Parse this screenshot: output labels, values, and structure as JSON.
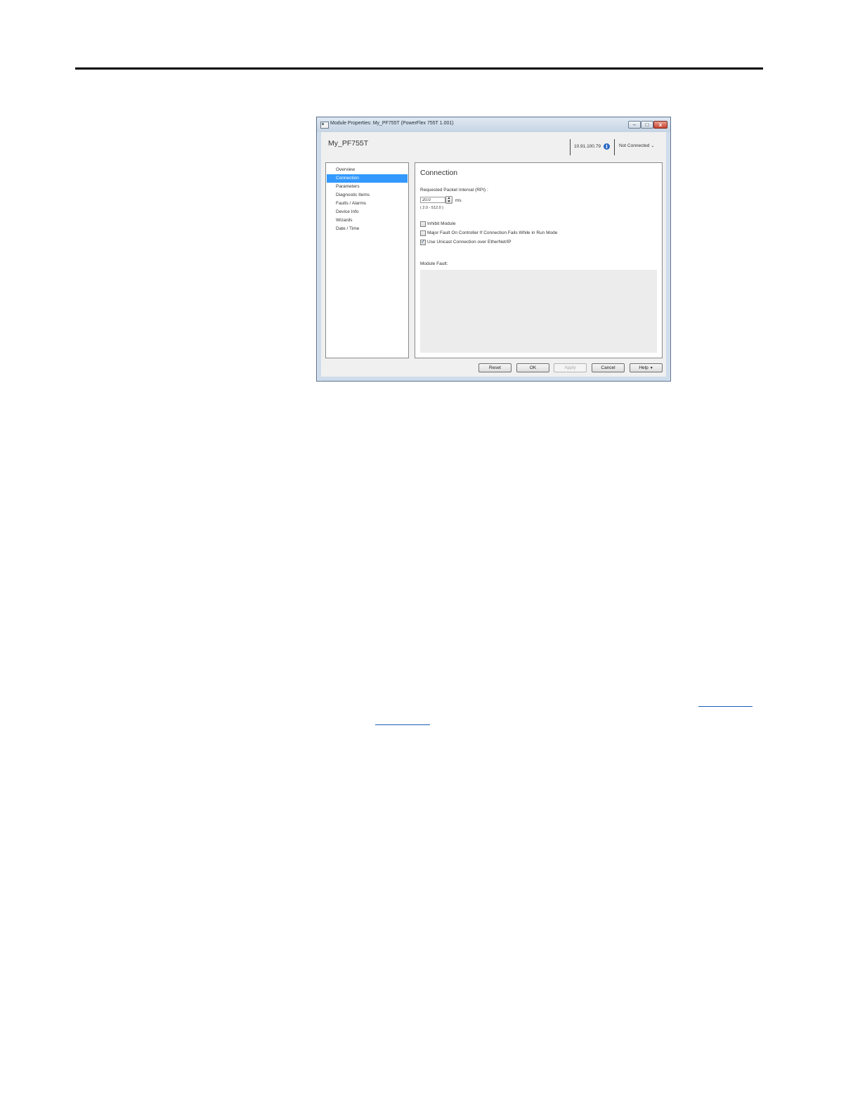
{
  "window": {
    "title": "Module Properties:  My_PF755T (PowerFlex 755T 1.001)",
    "minimize_glyph": "–",
    "maximize_glyph": "□",
    "close_glyph": "x"
  },
  "header": {
    "device_name": "My_PF755T",
    "ip_address": "10.91.100.79",
    "info_glyph": "i",
    "connection_status": "Not Connected",
    "dropdown_glyph": "⌄"
  },
  "nav": {
    "active_index": 1,
    "items": [
      {
        "label": "Overview"
      },
      {
        "label": "Connection"
      },
      {
        "label": "Parameters"
      },
      {
        "label": "Diagnostic Items"
      },
      {
        "label": "Faults / Alarms"
      },
      {
        "label": "Device Info"
      },
      {
        "label": "Wizards"
      },
      {
        "label": "Date / Time"
      }
    ]
  },
  "content": {
    "title": "Connection",
    "rpi_label": "Requested Packet Interval (RPI) :",
    "rpi_value": "20.0",
    "rpi_unit": "ms",
    "rpi_range": "( 2.0  -  512.0 )",
    "checkboxes": [
      {
        "label": "Inhibit Module",
        "checked": false
      },
      {
        "label": "Major Fault On Controller If Connection Fails While in Run Mode",
        "checked": false
      },
      {
        "label": "Use Unicast Connection over EtherNet/IP",
        "checked": true
      }
    ],
    "check_glyph": "✓",
    "module_fault_label": "Module Fault:"
  },
  "buttons": {
    "reset": "Reset",
    "ok": "OK",
    "apply": "Apply",
    "cancel": "Cancel",
    "help": "Help",
    "help_arrow": "▼"
  },
  "colors": {
    "selection": "#3399ff",
    "window_frame": "#cfdceb",
    "close_button": "#c84530"
  }
}
